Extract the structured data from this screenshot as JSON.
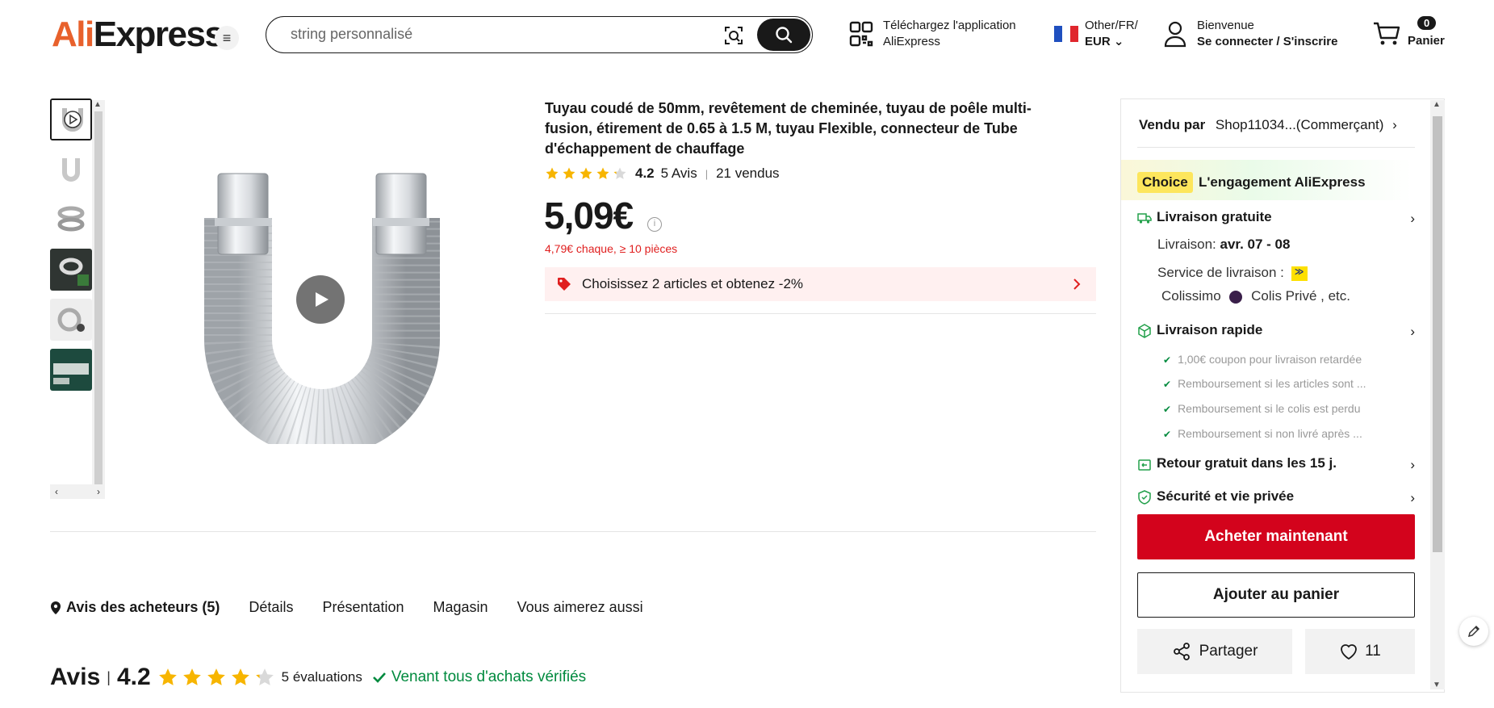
{
  "header": {
    "logo_prefix": "Ali",
    "logo_suffix": "Express",
    "search": {
      "placeholder": "string personnalisé"
    },
    "app_download": {
      "line1": "Téléchargez l'application",
      "line2": "AliExpress"
    },
    "locale": {
      "region": "Other/FR/",
      "currency": "EUR"
    },
    "account": {
      "greeting": "Bienvenue",
      "action": "Se connecter / S'inscrire"
    },
    "cart": {
      "count": "0",
      "label": "Panier"
    }
  },
  "product": {
    "title": "Tuyau coudé de 50mm, revêtement de cheminée, tuyau de poêle multi-fusion, étirement de 0.65 à 1.5 M, tuyau Flexible, connecteur de Tube d'échappement de chauffage",
    "rating": "4.2",
    "rating_fraction": 0.84,
    "reviews_count": "5 Avis",
    "sold": "21 vendus",
    "price": "5,09€",
    "bulk_price": "4,79€ chaque, ≥ 10 pièces",
    "promo": "Choisissez 2 articles et obtenez -2%"
  },
  "thumbnails": [
    {
      "name": "thumb-video",
      "icon": "play-icon"
    },
    {
      "name": "thumb-u-pipe"
    },
    {
      "name": "thumb-coiled-pipe"
    },
    {
      "name": "thumb-pipe-dark"
    },
    {
      "name": "thumb-pipe-rolled"
    },
    {
      "name": "thumb-pipe-green"
    }
  ],
  "tabs": [
    {
      "label": "Avis des acheteurs (5)",
      "active": true
    },
    {
      "label": "Détails"
    },
    {
      "label": "Présentation"
    },
    {
      "label": "Magasin"
    },
    {
      "label": "Vous aimerez aussi"
    }
  ],
  "reviews_summary": {
    "heading": "Avis",
    "score": "4.2",
    "count": "5 évaluations",
    "verified": "Venant tous d'achats vérifiés"
  },
  "panel": {
    "seller_label": "Vendu par",
    "seller_name": "Shop11034...(Commerçant)",
    "choice_badge": "Choice",
    "choice_text": "L'engagement AliExpress",
    "free_shipping": "Livraison gratuite",
    "delivery_label": "Livraison:",
    "delivery_dates": "avr. 07 - 08",
    "service_label": "Service de livraison :",
    "carrier1": "Colissimo",
    "carrier2": "Colis Privé , etc.",
    "fast_delivery": "Livraison rapide",
    "guarantees": [
      "1,00€ coupon pour livraison retardée",
      "Remboursement si les articles sont ...",
      "Remboursement si le colis est perdu",
      "Remboursement si non livré après ..."
    ],
    "free_return": "Retour gratuit dans les 15 j.",
    "security": "Sécurité et vie privée",
    "buy_now": "Acheter maintenant",
    "add_to_cart": "Ajouter au panier",
    "share": "Partager",
    "likes": "11"
  },
  "colors": {
    "accent_red": "#d3031c",
    "logo_orange": "#e8612c",
    "verified_green": "#008a3e",
    "star_yellow": "#f7b500",
    "choice_yellow": "#fde65c"
  }
}
